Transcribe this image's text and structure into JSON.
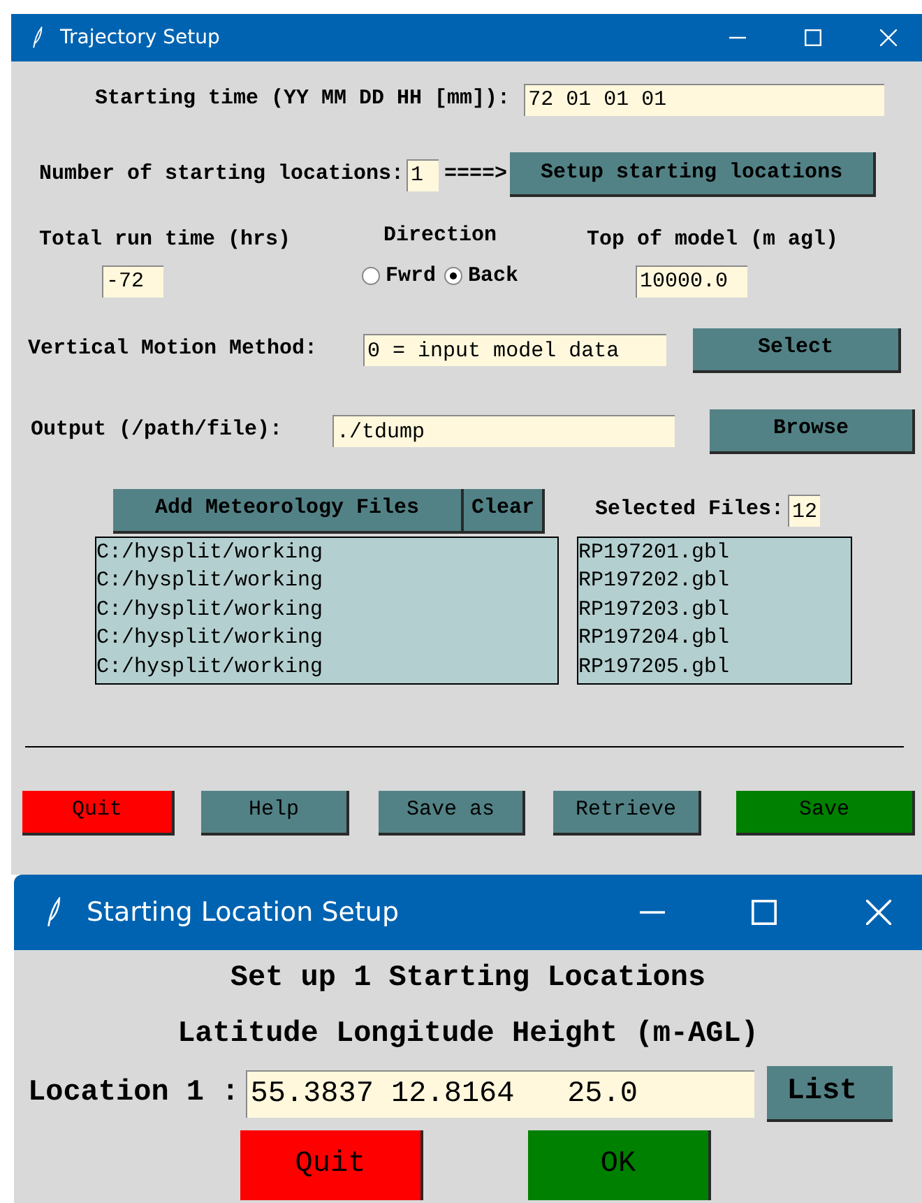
{
  "main_window": {
    "title": "Trajectory Setup",
    "starting_time": {
      "label": "Starting time (YY MM DD HH [mm]):",
      "value": "72 01 01 01"
    },
    "locations": {
      "label": "Number of starting locations:",
      "value": "1",
      "arrow": "====>",
      "button": "Setup starting locations"
    },
    "run_time": {
      "label": "Total run time (hrs)",
      "value": "-72"
    },
    "direction": {
      "label": "Direction",
      "options": [
        {
          "label": "Fwrd",
          "selected": false
        },
        {
          "label": "Back",
          "selected": true
        }
      ]
    },
    "top_of_model": {
      "label": "Top of model (m agl)",
      "value": "10000.0"
    },
    "vertical_motion": {
      "label": "Vertical Motion Method:",
      "value": "0 = input model data",
      "button": "Select"
    },
    "output": {
      "label": "Output (/path/file):",
      "value": "./tdump",
      "button": "Browse"
    },
    "meteorology": {
      "add_button": "Add Meteorology Files",
      "clear_button": "Clear",
      "selected_label": "Selected Files:",
      "selected_count": "12",
      "directories": [
        "C:/hysplit/working",
        "C:/hysplit/working",
        "C:/hysplit/working",
        "C:/hysplit/working",
        "C:/hysplit/working"
      ],
      "files": [
        "RP197201.gbl",
        "RP197202.gbl",
        "RP197203.gbl",
        "RP197204.gbl",
        "RP197205.gbl"
      ]
    },
    "buttons": [
      {
        "label": "Quit",
        "color": "#ff0000"
      },
      {
        "label": "Help",
        "color": "#528286"
      },
      {
        "label": "Save as",
        "color": "#528286"
      },
      {
        "label": "Retrieve",
        "color": "#528286"
      },
      {
        "label": "Save",
        "color": "#008000"
      }
    ]
  },
  "location_window": {
    "title": "Starting Location Setup",
    "heading": "Set up 1 Starting Locations",
    "columns": "Latitude Longitude Height (m-AGL)",
    "location": {
      "label": "Location 1 :",
      "value": "55.3837 12.8164   25.0",
      "button": "List"
    },
    "buttons": [
      {
        "label": "Quit",
        "color": "#ff0000"
      },
      {
        "label": "OK",
        "color": "#008000"
      }
    ]
  }
}
